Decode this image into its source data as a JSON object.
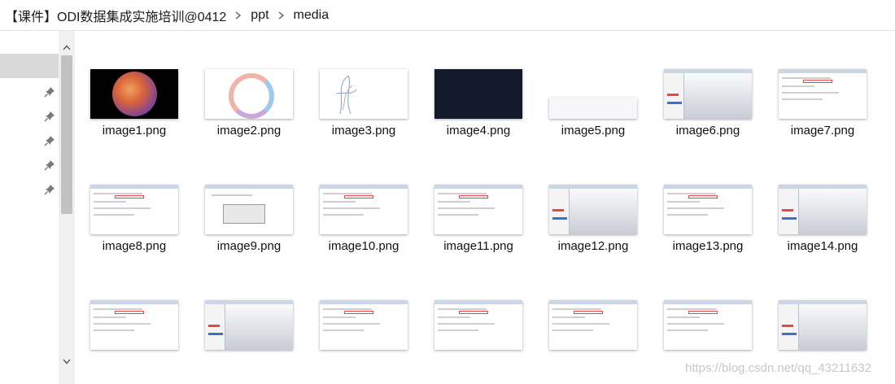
{
  "breadcrumb": {
    "items": [
      "【课件】ODI数据集成实施培训@0412",
      "ppt",
      "media"
    ]
  },
  "files": [
    {
      "name": "image1.png",
      "thumb": "sphere"
    },
    {
      "name": "image2.png",
      "thumb": "ring"
    },
    {
      "name": "image3.png",
      "thumb": "sketch"
    },
    {
      "name": "image4.png",
      "thumb": "dark"
    },
    {
      "name": "image5.png",
      "thumb": "light"
    },
    {
      "name": "image6.png",
      "thumb": "window"
    },
    {
      "name": "image7.png",
      "thumb": "form"
    },
    {
      "name": "image8.png",
      "thumb": "form"
    },
    {
      "name": "image9.png",
      "thumb": "dialog"
    },
    {
      "name": "image10.png",
      "thumb": "form"
    },
    {
      "name": "image11.png",
      "thumb": "form"
    },
    {
      "name": "image12.png",
      "thumb": "window"
    },
    {
      "name": "image13.png",
      "thumb": "form"
    },
    {
      "name": "image14.png",
      "thumb": "window"
    },
    {
      "name": "",
      "thumb": "form"
    },
    {
      "name": "",
      "thumb": "window"
    },
    {
      "name": "",
      "thumb": "form"
    },
    {
      "name": "",
      "thumb": "form"
    },
    {
      "name": "",
      "thumb": "form"
    },
    {
      "name": "",
      "thumb": "form"
    },
    {
      "name": "",
      "thumb": "window"
    }
  ],
  "watermark": "https://blog.csdn.net/qq_43211632",
  "icons": {
    "breadcrumb_separator": "chevron-right-icon",
    "pin": "pin-icon",
    "scroll_up": "chevron-up-icon",
    "scroll_down": "chevron-down-icon"
  }
}
